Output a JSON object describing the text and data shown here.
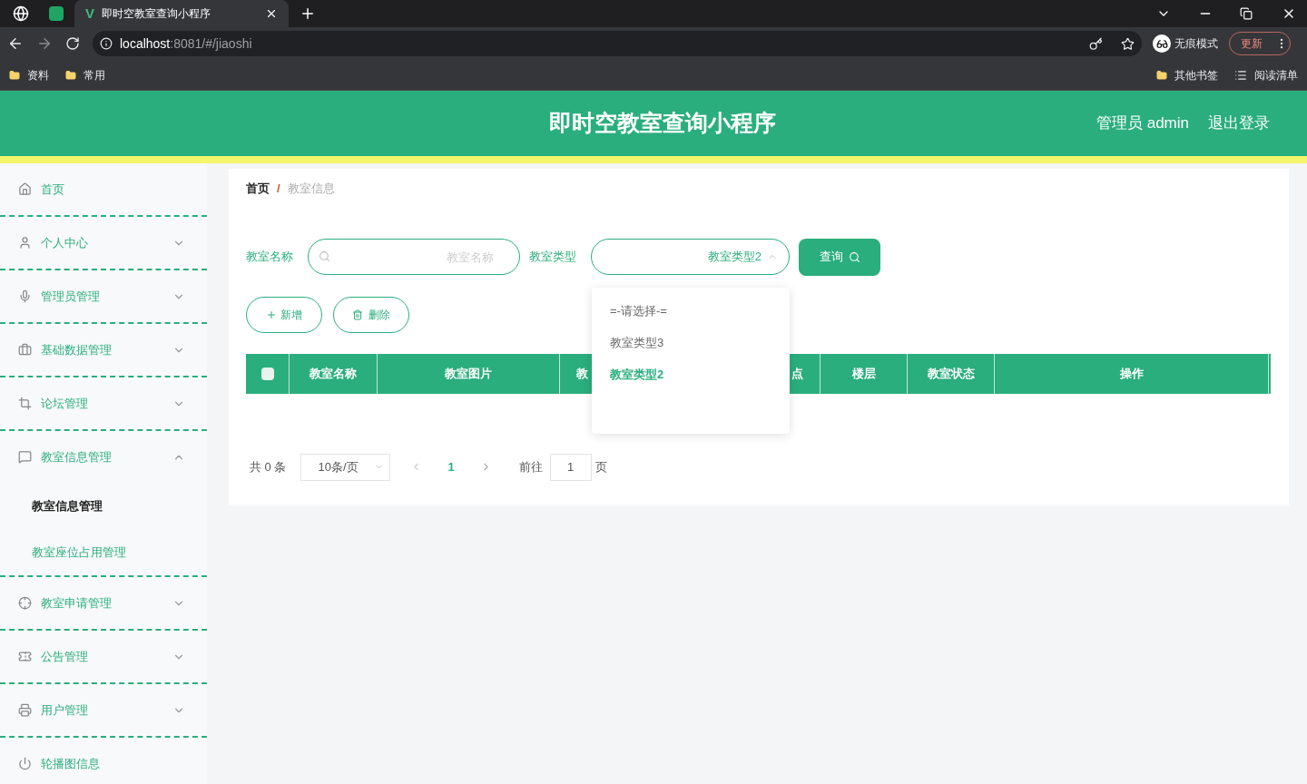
{
  "browser": {
    "tab_logo": "V",
    "tab_title": "即时空教室查询小程序",
    "url_host": "localhost",
    "url_path": ":8081/#/jiaoshi",
    "profile": "无痕模式",
    "update": "更新",
    "bookmarks": [
      "资料",
      "常用"
    ],
    "bookmarks_right": [
      "其他书签",
      "阅读清单"
    ]
  },
  "header": {
    "title": "即时空教室查询小程序",
    "user": "管理员 admin",
    "logout": "退出登录"
  },
  "sidebar": [
    {
      "kind": "link",
      "label": "首页"
    },
    {
      "kind": "group",
      "label": "个人中心",
      "expanded": false
    },
    {
      "kind": "group",
      "label": "管理员管理",
      "expanded": false
    },
    {
      "kind": "group",
      "label": "基础数据管理",
      "expanded": false
    },
    {
      "kind": "group",
      "label": "论坛管理",
      "expanded": false
    },
    {
      "kind": "group",
      "label": "教室信息管理",
      "expanded": true,
      "children": [
        {
          "label": "教室信息管理",
          "selected": true
        },
        {
          "label": "教室座位占用管理",
          "selected": false
        }
      ]
    },
    {
      "kind": "group",
      "label": "教室申请管理",
      "expanded": false
    },
    {
      "kind": "group",
      "label": "公告管理",
      "expanded": false
    },
    {
      "kind": "group",
      "label": "用户管理",
      "expanded": false
    },
    {
      "kind": "link",
      "label": "轮播图信息"
    }
  ],
  "breadcrumb": [
    "首页",
    "教室信息"
  ],
  "breadcrumb_separator": "/",
  "filters": {
    "name_label": "教室名称",
    "name_placeholder": "教室名称",
    "type_label": "教室类型",
    "type_value": "教室类型2",
    "query": "查询"
  },
  "dropdown": [
    {
      "label": "=-请选择-=",
      "selected": false
    },
    {
      "label": "教室类型3",
      "selected": false
    },
    {
      "label": "教室类型2",
      "selected": true
    }
  ],
  "actions": [
    "新增",
    "删除"
  ],
  "table": {
    "select_all_checked": false,
    "columns": [
      "教室名称",
      "教室图片",
      "教",
      "点",
      "楼层",
      "教室状态",
      "操作"
    ]
  },
  "pagination": {
    "total": "共 0 条",
    "page_size": "10条/页",
    "current": "1",
    "goto": "前往",
    "goto_value": "1",
    "page_unit": "页"
  }
}
